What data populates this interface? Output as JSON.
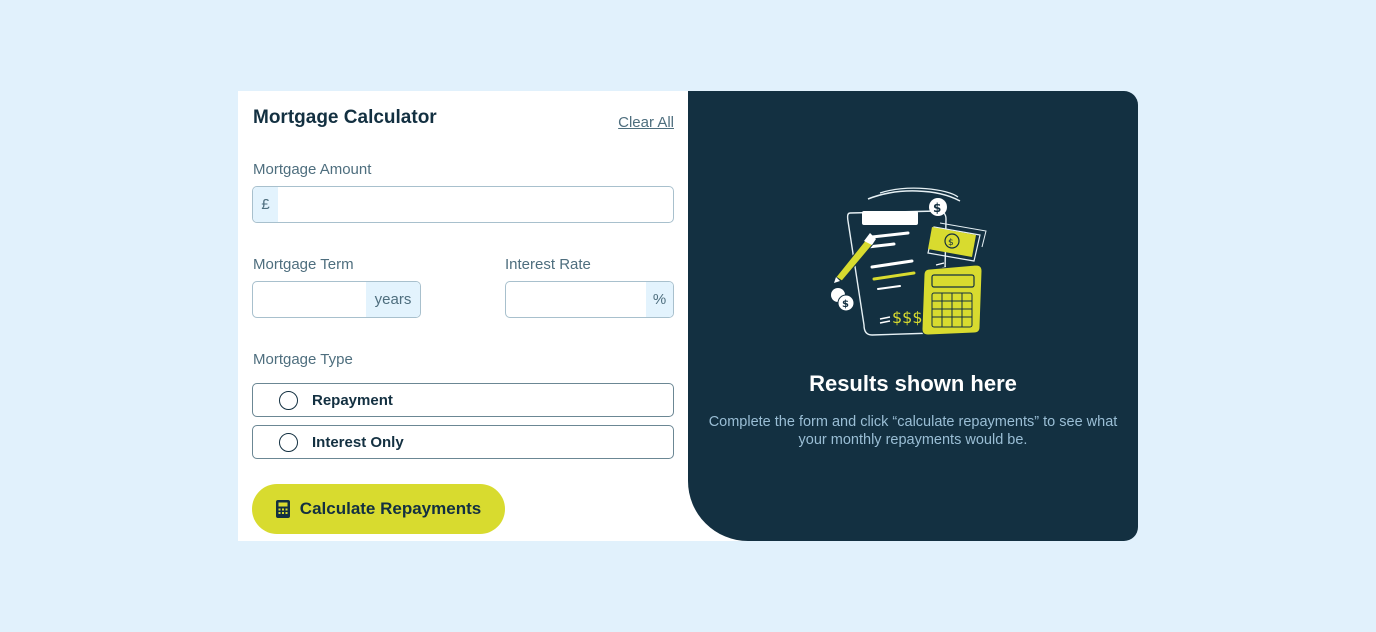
{
  "form": {
    "title": "Mortgage Calculator",
    "clear_all": "Clear All",
    "amount": {
      "label": "Mortgage Amount",
      "prefix": "£",
      "value": "",
      "placeholder": ""
    },
    "term": {
      "label": "Mortgage Term",
      "suffix": "years",
      "value": "",
      "placeholder": ""
    },
    "rate": {
      "label": "Interest Rate",
      "suffix": "%",
      "value": "",
      "placeholder": ""
    },
    "type": {
      "label": "Mortgage Type",
      "options": [
        {
          "label": "Repayment",
          "selected": false
        },
        {
          "label": "Interest Only",
          "selected": false
        }
      ]
    },
    "submit_label": "Calculate Repayments",
    "submit_icon": "calculator-icon"
  },
  "results": {
    "illustration": "empty-results-illustration",
    "title": "Results shown here",
    "text": "Complete the form and click “calculate repayments” to see what your monthly repayments would be."
  },
  "colors": {
    "background": "#e1f1fc",
    "dark": "#133041",
    "accent": "#d8db2f",
    "muted": "#4e6e7e"
  }
}
